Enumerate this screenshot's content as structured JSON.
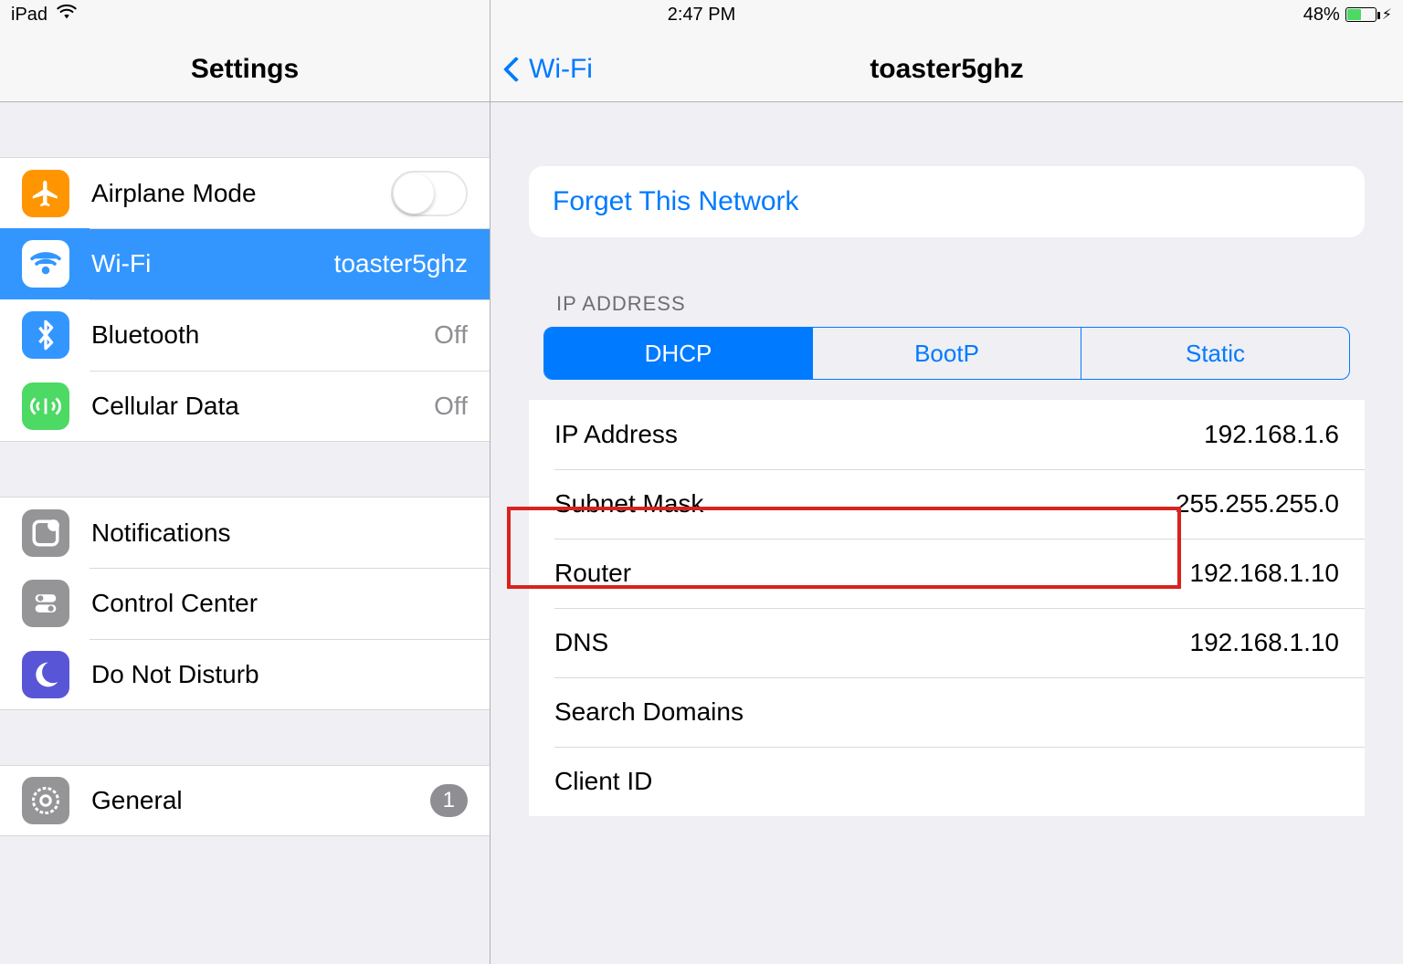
{
  "statusbar": {
    "device": "iPad",
    "time": "2:47 PM",
    "battery_pct": "48%",
    "battery_level_pct": 48
  },
  "sidebar": {
    "title": "Settings",
    "groups": [
      {
        "items": [
          {
            "id": "airplane",
            "label": "Airplane Mode",
            "type": "toggle",
            "toggled": false
          },
          {
            "id": "wifi",
            "label": "Wi-Fi",
            "type": "detail",
            "value": "toaster5ghz",
            "selected": true
          },
          {
            "id": "bluetooth",
            "label": "Bluetooth",
            "type": "detail",
            "value": "Off"
          },
          {
            "id": "cellular",
            "label": "Cellular Data",
            "type": "detail",
            "value": "Off"
          }
        ]
      },
      {
        "items": [
          {
            "id": "notifications",
            "label": "Notifications",
            "type": "drill"
          },
          {
            "id": "control-center",
            "label": "Control Center",
            "type": "drill"
          },
          {
            "id": "dnd",
            "label": "Do Not Disturb",
            "type": "drill"
          }
        ]
      },
      {
        "items": [
          {
            "id": "general",
            "label": "General",
            "type": "drill",
            "badge": "1"
          }
        ]
      }
    ]
  },
  "detail": {
    "back_label": "Wi-Fi",
    "title": "toaster5ghz",
    "forget_label": "Forget This Network",
    "ip_section_header": "IP ADDRESS",
    "segments": [
      "DHCP",
      "BootP",
      "Static"
    ],
    "segment_active_index": 0,
    "fields": [
      {
        "key": "IP Address",
        "value": "192.168.1.6"
      },
      {
        "key": "Subnet Mask",
        "value": "255.255.255.0"
      },
      {
        "key": "Router",
        "value": "192.168.1.10",
        "highlighted": true
      },
      {
        "key": "DNS",
        "value": "192.168.1.10"
      },
      {
        "key": "Search Domains",
        "value": ""
      },
      {
        "key": "Client ID",
        "value": ""
      }
    ]
  }
}
